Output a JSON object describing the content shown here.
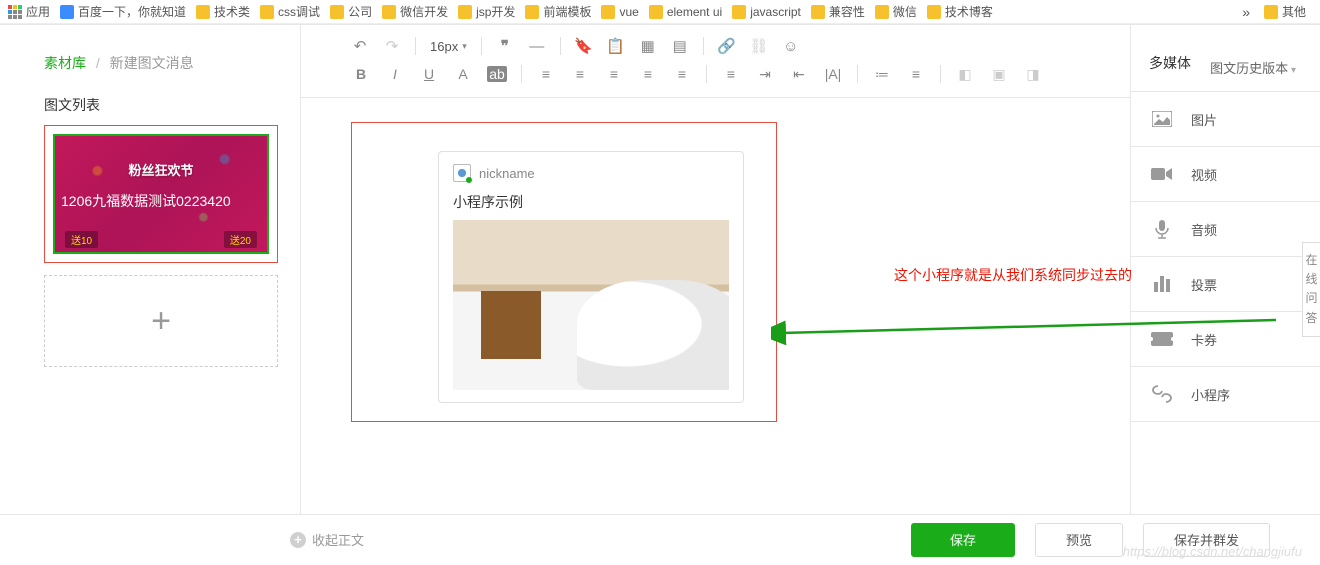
{
  "bookmarks": {
    "apps": "应用",
    "items": [
      "百度一下，你就知道",
      "技术类",
      "css调试",
      "公司",
      "微信开发",
      "jsp开发",
      "前端模板",
      "vue",
      "element ui",
      "javascript",
      "兼容性",
      "微信",
      "技术博客"
    ],
    "more": "»",
    "other": "其他"
  },
  "header": {
    "crumb_a": "素材库",
    "crumb_b": "新建图文消息",
    "history": "图文历史版本"
  },
  "left": {
    "list_label": "图文列表",
    "thumb_banner": "粉丝狂欢节",
    "thumb_text": "1206九福数据测试0223420",
    "badge_l": "送10",
    "badge_r": "送20"
  },
  "toolbar": {
    "fontsize": "16px"
  },
  "editor": {
    "nickname": "nickname",
    "card_title": "小程序示例"
  },
  "annotation": "这个小程序就是从我们系统同步过去的",
  "media": {
    "title": "多媒体",
    "items": [
      "图片",
      "视频",
      "音频",
      "投票",
      "卡券",
      "小程序"
    ]
  },
  "sidetab": {
    "a": "在",
    "b": "线",
    "c": "问",
    "d": "答"
  },
  "bottom": {
    "collapse": "收起正文",
    "save": "保存",
    "preview": "预览",
    "send": "保存并群发"
  },
  "watermark": "https://blog.csdn.net/changjiufu"
}
